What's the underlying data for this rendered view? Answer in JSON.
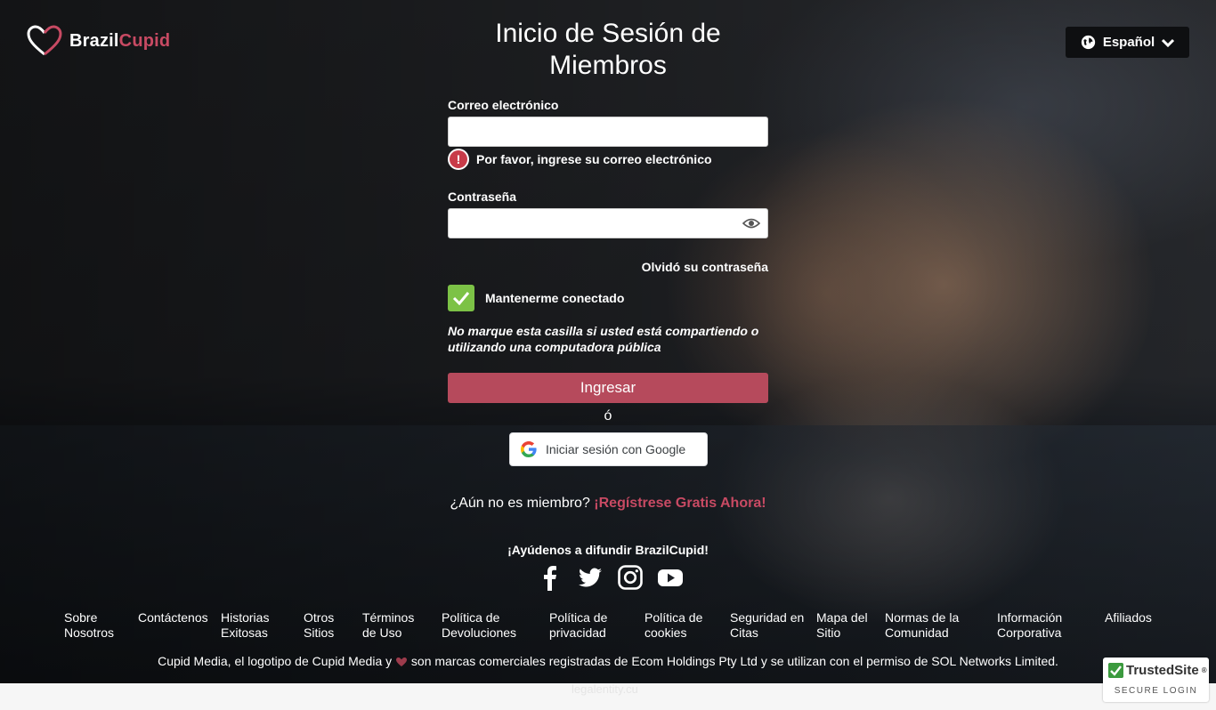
{
  "brand": {
    "part1": "Brazil",
    "part2": "Cupid",
    "accent_color": "#c84a63"
  },
  "language": {
    "label": "Español",
    "icon": "globe-icon"
  },
  "title": "Inicio de Sesión de Miembros",
  "form": {
    "email_label": "Correo electrónico",
    "email_value": "",
    "email_error": "Por favor, ingrese su correo electrónico",
    "password_label": "Contraseña",
    "password_value": "",
    "forgot": "Olvidó su contraseña",
    "keep_logged": "Mantenerme conectado",
    "keep_checked": true,
    "note": "No marque esta casilla si usted está compartiendo o utilizando una computadora pública",
    "submit": "Ingresar",
    "or": "ó",
    "google": "Iniciar sesión con Google"
  },
  "join": {
    "question": "¿Aún no es miembro?",
    "cta": "¡Regístrese Gratis Ahora!"
  },
  "spread": "¡Ayúdenos a difundir BrazilCupid!",
  "social": [
    "facebook-icon",
    "twitter-icon",
    "instagram-icon",
    "youtube-icon"
  ],
  "footer_links": [
    "Sobre Nosotros",
    "Contáctenos",
    "Historias Exitosas",
    "Otros Sitios",
    "Términos de Uso",
    "Política de Devoluciones",
    "Política de privacidad",
    "Política de cookies",
    "Seguridad en Citas",
    "Mapa del Sitio",
    "Normas de la Comunidad",
    "Información Corporativa",
    "Afiliados"
  ],
  "legal": {
    "before": "Cupid Media, el logotipo de Cupid Media y",
    "after": "son marcas comerciales registradas de Ecom Holdings Pty Ltd y se utilizan con el permiso de SOL Networks Limited."
  },
  "trusted": {
    "name": "TrustedSite",
    "tm": "®",
    "sub": "SECURE LOGIN"
  },
  "ghost_text": "legalentity.cu"
}
